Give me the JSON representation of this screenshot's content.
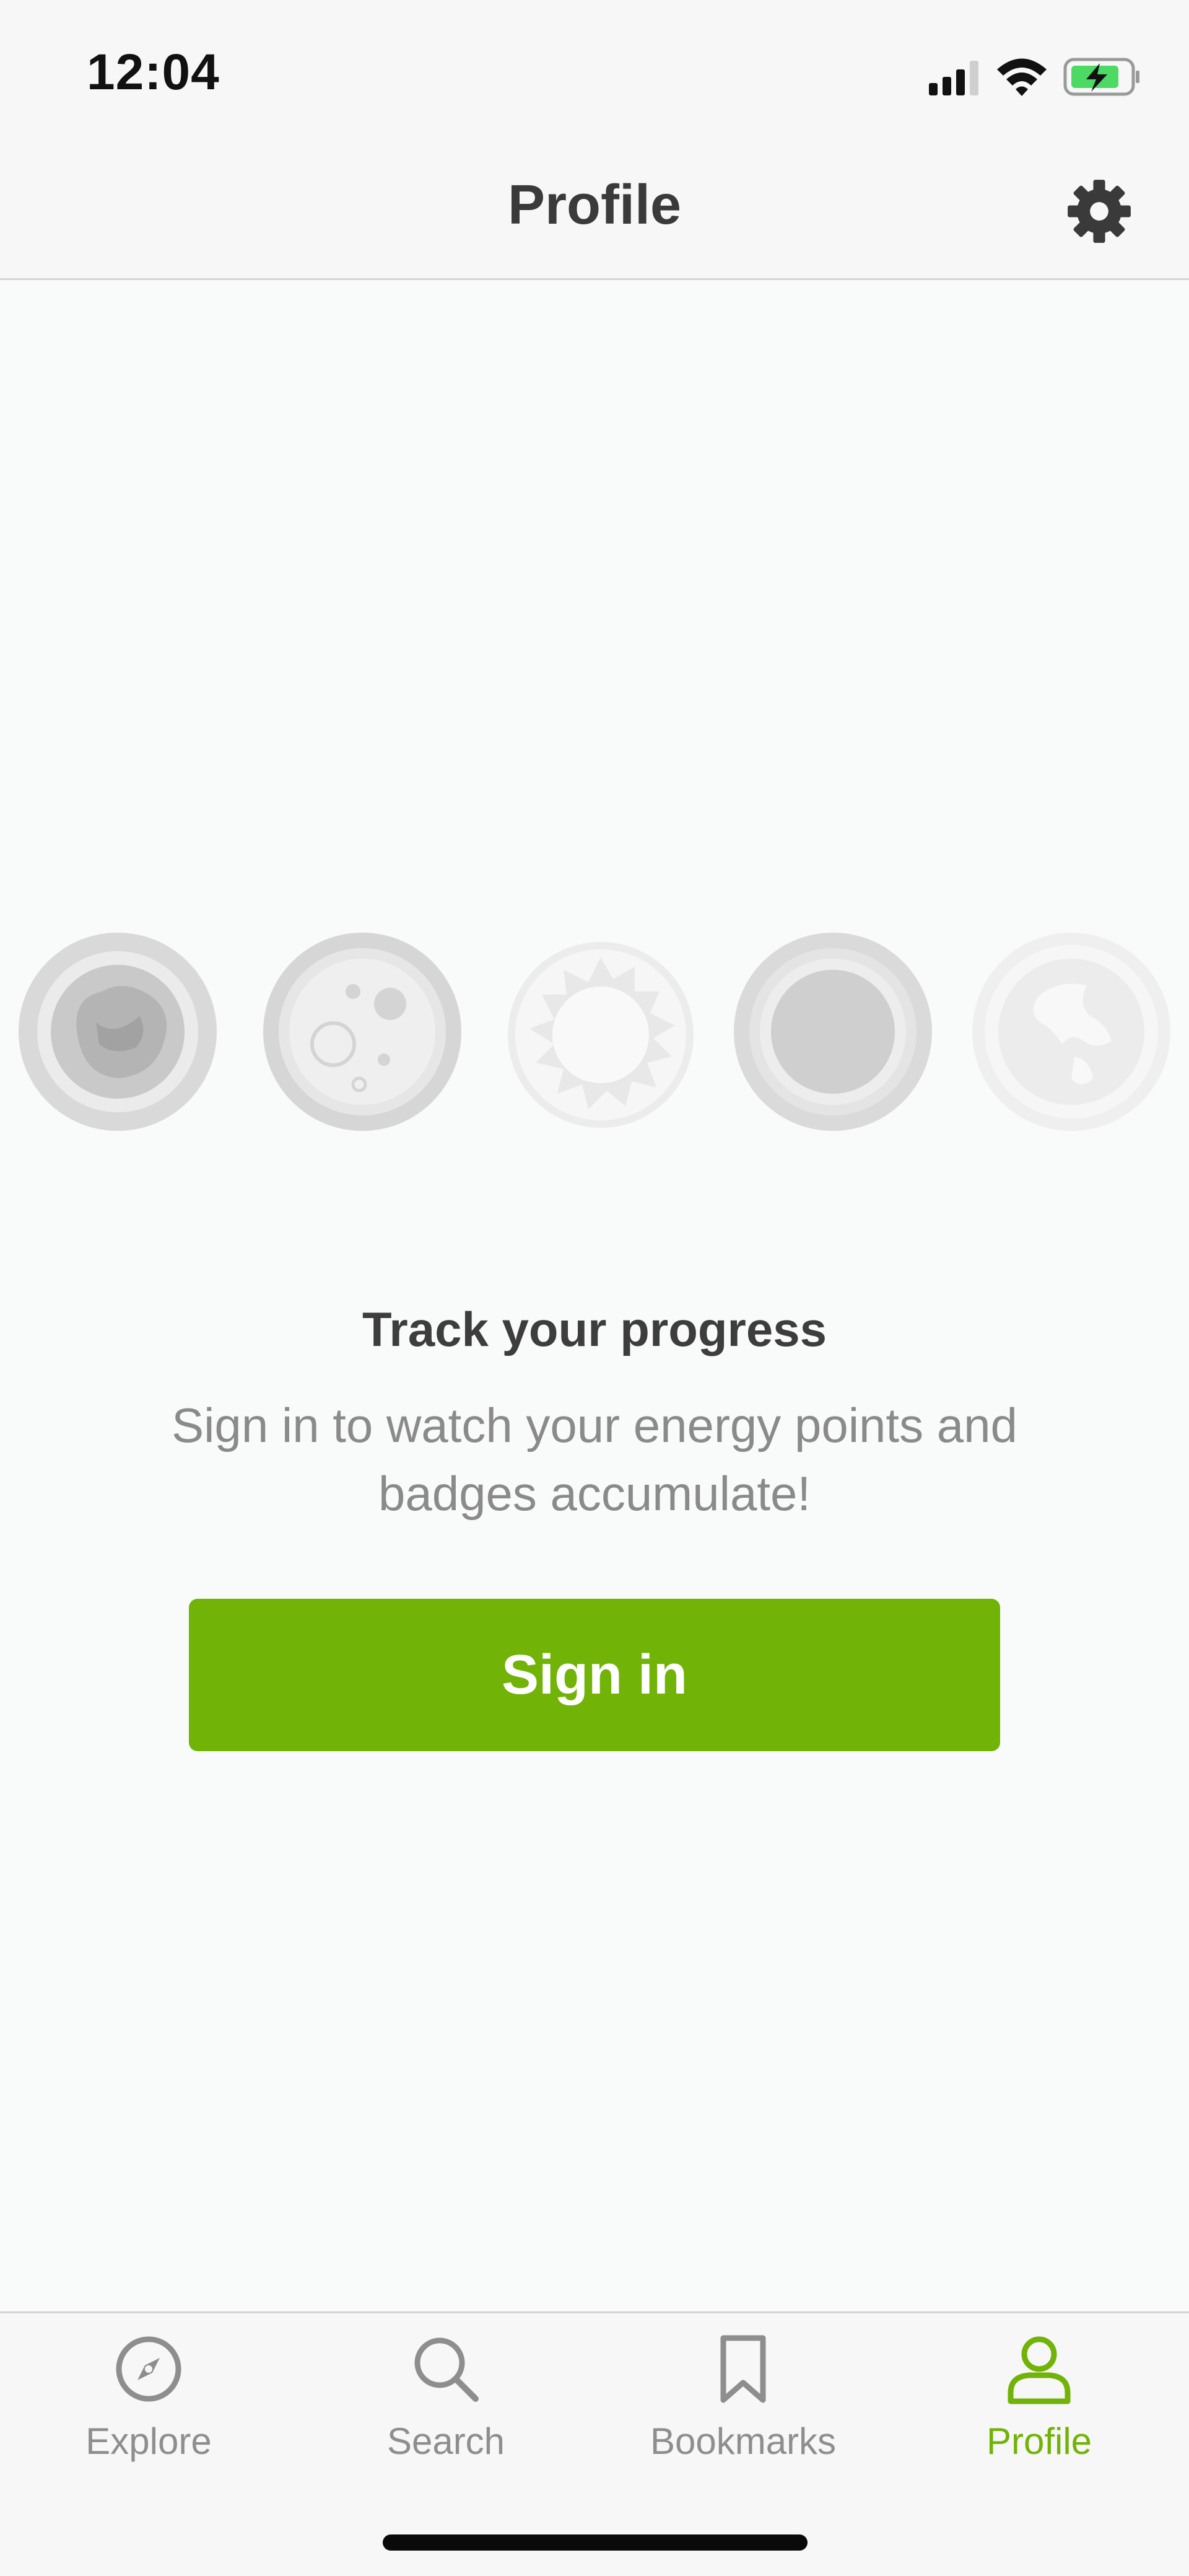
{
  "status_bar": {
    "time": "12:04"
  },
  "nav": {
    "title": "Profile"
  },
  "main": {
    "badges": [
      {
        "name": "meteorite-badge"
      },
      {
        "name": "moon-badge"
      },
      {
        "name": "sun-badge"
      },
      {
        "name": "black-hole-badge"
      },
      {
        "name": "earth-badge"
      }
    ],
    "headline": "Track your progress",
    "subtext": "Sign in to watch your energy points and badges accumulate!",
    "signin_label": "Sign in"
  },
  "tabs": [
    {
      "label": "Explore",
      "icon": "compass-icon",
      "active": false
    },
    {
      "label": "Search",
      "icon": "search-icon",
      "active": false
    },
    {
      "label": "Bookmarks",
      "icon": "bookmark-icon",
      "active": false
    },
    {
      "label": "Profile",
      "icon": "person-icon",
      "active": true
    }
  ],
  "colors": {
    "accent": "#71b307",
    "inactive_tab": "#8e8e8e",
    "background": "#f9fafa"
  }
}
